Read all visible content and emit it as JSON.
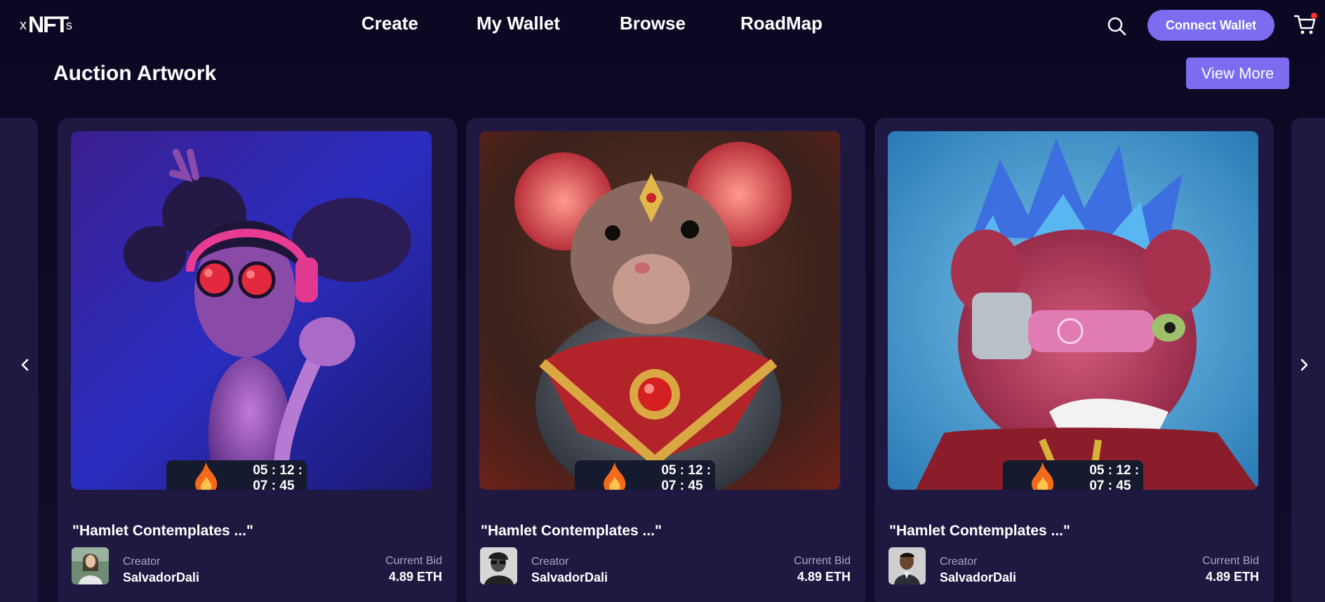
{
  "header": {
    "logo_text": "xNFTs",
    "nav": [
      "Create",
      "My Wallet",
      "Browse",
      "RoadMap"
    ],
    "connect_wallet_label": "Connect Wallet",
    "cart_has_notification": true
  },
  "section": {
    "title": "Auction Artwork",
    "view_more_label": "View More"
  },
  "cards": [
    {
      "artwork": "3D cartoon girl with pink headphones and round red glasses",
      "timer": "05 : 12 : 07 : 45",
      "title": "\"Hamlet Contemplates ...\"",
      "creator_label": "Creator",
      "creator_name": "SalvadorDali",
      "bid_label": "Current Bid",
      "bid_value": "4.89 ETH"
    },
    {
      "artwork": "3D rat wearing golden armor with red gem",
      "timer": "05 : 12 : 07 : 45",
      "title": "\"Hamlet Contemplates ...\"",
      "creator_label": "Creator",
      "creator_name": "SalvadorDali",
      "bid_label": "Current Bid",
      "bid_value": "4.89 ETH"
    },
    {
      "artwork": "Pink lion with blue mohawk and cyber eyepiece",
      "timer": "05 : 12 : 07 : 45",
      "title": "\"Hamlet Contemplates ...\"",
      "creator_label": "Creator",
      "creator_name": "SalvadorDali",
      "bid_label": "Current Bid",
      "bid_value": "4.89 ETH"
    }
  ],
  "colors": {
    "background": "#0e0a24",
    "card": "#1f1942",
    "accent": "#7c6cf0",
    "timer_bg": "#161a2e",
    "muted_text": "#a9a5c4"
  },
  "icons": {
    "search": "search-icon",
    "cart": "cart-icon",
    "prev": "chevron-left-icon",
    "next": "chevron-right-icon",
    "fire": "fire-icon"
  }
}
